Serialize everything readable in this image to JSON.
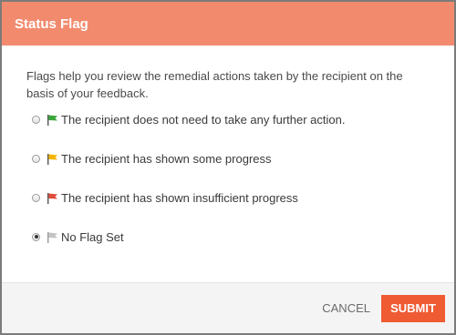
{
  "dialog": {
    "title": "Status Flag",
    "description": "Flags help you review the remedial actions taken by the recipient on the basis of your feedback.",
    "options": [
      {
        "label": "The recipient does not need to take any further action.",
        "flag_color": "#3aa53a",
        "icon": "green-flag-icon",
        "selected": false
      },
      {
        "label": "The recipient has shown some progress",
        "flag_color": "#f5b400",
        "icon": "yellow-flag-icon",
        "selected": false
      },
      {
        "label": "The recipient has shown insufficient progress",
        "flag_color": "#e04b3b",
        "icon": "red-flag-icon",
        "selected": false
      },
      {
        "label": "No Flag Set",
        "flag_color": "#c4c4c4",
        "icon": "grey-flag-icon",
        "selected": true
      }
    ],
    "cancel_label": "CANCEL",
    "submit_label": "SUBMIT"
  },
  "colors": {
    "header_bg": "#f28b6e",
    "submit_bg": "#ef5b33",
    "overlay": "#7b7b7b"
  }
}
